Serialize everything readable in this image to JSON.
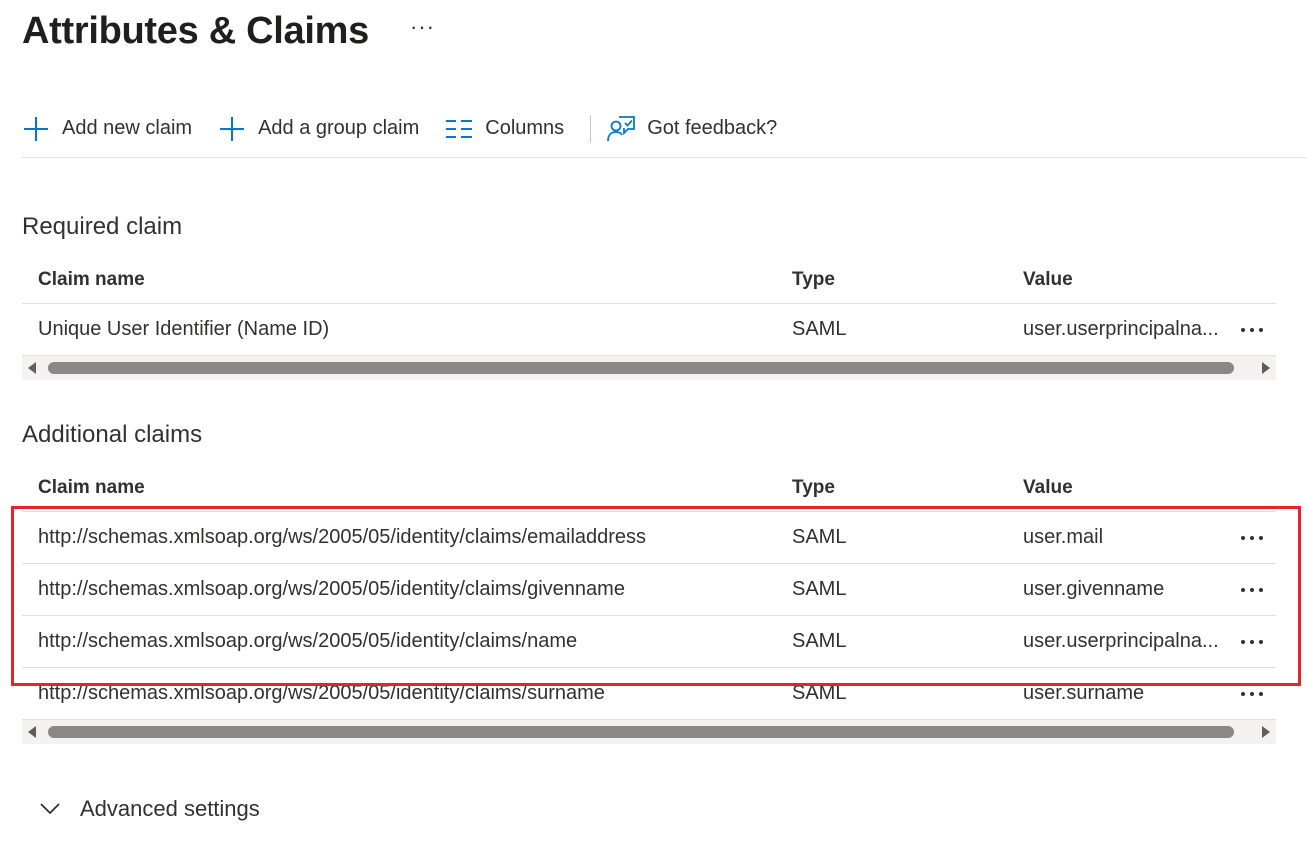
{
  "page": {
    "title": "Attributes & Claims",
    "more": "···"
  },
  "toolbar": {
    "add_claim": "Add new claim",
    "add_group_claim": "Add a group claim",
    "columns": "Columns",
    "feedback": "Got feedback?"
  },
  "required": {
    "heading": "Required claim",
    "columns": {
      "name": "Claim name",
      "type": "Type",
      "value": "Value"
    },
    "rows": [
      {
        "name": "Unique User Identifier (Name ID)",
        "type": "SAML",
        "value": "user.userprincipalna..."
      }
    ]
  },
  "additional": {
    "heading": "Additional claims",
    "columns": {
      "name": "Claim name",
      "type": "Type",
      "value": "Value"
    },
    "rows": [
      {
        "name": "http://schemas.xmlsoap.org/ws/2005/05/identity/claims/emailaddress",
        "type": "SAML",
        "value": "user.mail"
      },
      {
        "name": "http://schemas.xmlsoap.org/ws/2005/05/identity/claims/givenname",
        "type": "SAML",
        "value": "user.givenname"
      },
      {
        "name": "http://schemas.xmlsoap.org/ws/2005/05/identity/claims/name",
        "type": "SAML",
        "value": "user.userprincipalna..."
      },
      {
        "name": "http://schemas.xmlsoap.org/ws/2005/05/identity/claims/surname",
        "type": "SAML",
        "value": "user.surname"
      }
    ]
  },
  "advanced": {
    "label": "Advanced settings"
  },
  "colors": {
    "accent": "#0078d4",
    "highlight": "#e3242b"
  }
}
